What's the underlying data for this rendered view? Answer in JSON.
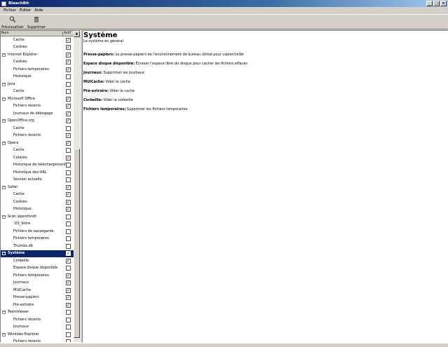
{
  "window": {
    "title": "BleachBit"
  },
  "menu": [
    "Fichier",
    "Éditer",
    "Aide"
  ],
  "toolbar": {
    "preview_label": "Prévisualiser",
    "delete_label": "Supprimer"
  },
  "tree": {
    "col_name": "Nom",
    "col_active": "Actif",
    "rows": [
      {
        "label": "Cache",
        "kind": "child",
        "checked": true
      },
      {
        "label": "Cookies",
        "kind": "child",
        "checked": true
      },
      {
        "label": "Internet Explorer",
        "kind": "group",
        "checked": true
      },
      {
        "label": "Cookies",
        "kind": "child",
        "checked": true
      },
      {
        "label": "Fichiers temporaires",
        "kind": "child",
        "checked": true
      },
      {
        "label": "Historique",
        "kind": "child",
        "checked": false
      },
      {
        "label": "Java",
        "kind": "group",
        "checked": false
      },
      {
        "label": "Cache",
        "kind": "child",
        "checked": false
      },
      {
        "label": "Microsoft Office",
        "kind": "group",
        "checked": true
      },
      {
        "label": "Fichiers récents",
        "kind": "child",
        "checked": true
      },
      {
        "label": "Journaux de débogage",
        "kind": "child",
        "checked": true
      },
      {
        "label": "OpenOffice.org",
        "kind": "group",
        "checked": true
      },
      {
        "label": "Cache",
        "kind": "child",
        "checked": false
      },
      {
        "label": "Fichiers récents",
        "kind": "child",
        "checked": true
      },
      {
        "label": "Opera",
        "kind": "group",
        "checked": true
      },
      {
        "label": "Cache",
        "kind": "child",
        "checked": false
      },
      {
        "label": "Cookies",
        "kind": "child",
        "checked": true
      },
      {
        "label": "Historique de téléchargement",
        "kind": "child",
        "checked": false
      },
      {
        "label": "Historique des URL",
        "kind": "child",
        "checked": false
      },
      {
        "label": "Session actuelle",
        "kind": "child",
        "checked": false
      },
      {
        "label": "Safari",
        "kind": "group",
        "checked": true
      },
      {
        "label": "Cache",
        "kind": "child",
        "checked": true
      },
      {
        "label": "Cookies",
        "kind": "child",
        "checked": true
      },
      {
        "label": "Historique",
        "kind": "child",
        "checked": true
      },
      {
        "label": "Scan approfondi",
        "kind": "group",
        "checked": false
      },
      {
        "label": ".DS_Store",
        "kind": "child",
        "checked": false
      },
      {
        "label": "Fichiers de sauvegarde",
        "kind": "child",
        "checked": false
      },
      {
        "label": "Fichiers temporaires",
        "kind": "child",
        "checked": false
      },
      {
        "label": "Thumbs.db",
        "kind": "child",
        "checked": false
      },
      {
        "label": "Système",
        "kind": "group",
        "checked": true,
        "selected": true
      },
      {
        "label": "Corbeille",
        "kind": "child",
        "checked": true
      },
      {
        "label": "Espace disque disponible",
        "kind": "child",
        "checked": false
      },
      {
        "label": "Fichiers temporaires",
        "kind": "child",
        "checked": true
      },
      {
        "label": "Journaux",
        "kind": "child",
        "checked": true
      },
      {
        "label": "MUICache",
        "kind": "child",
        "checked": true
      },
      {
        "label": "Presse-papiers",
        "kind": "child",
        "checked": true
      },
      {
        "label": "Pré-extraire",
        "kind": "child",
        "checked": true
      },
      {
        "label": "TeamViewer",
        "kind": "group",
        "checked": false
      },
      {
        "label": "Fichiers récents",
        "kind": "child",
        "checked": false
      },
      {
        "label": "Journaux",
        "kind": "child",
        "checked": false
      },
      {
        "label": "Windows Explorer",
        "kind": "group",
        "checked": false
      },
      {
        "label": "Fichiers récents",
        "kind": "child",
        "checked": false
      }
    ]
  },
  "content": {
    "title": "Système",
    "subtitle": "Le système en général",
    "descriptions": [
      {
        "term": "Presse-papiers:",
        "text": " Le presse-papiers de l'environnement de bureau utilisé pour copier/coller"
      },
      {
        "term": "Espace disque disponible:",
        "text": " Écraser l'espace libre du disque pour cacher les fichiers effacés"
      },
      {
        "term": "Journaux:",
        "text": " Supprimer les journaux"
      },
      {
        "term": "MUICache:",
        "text": " Vider le cache"
      },
      {
        "term": "Pré-extraire:",
        "text": " Vider le cache"
      },
      {
        "term": "Corbeille:",
        "text": " Vider la corbeille"
      },
      {
        "term": "Fichiers temporaires:",
        "text": " Supprimer les fichiers temporaires"
      }
    ]
  },
  "icons": {
    "expander": "minus-box-icon",
    "check": "✓"
  }
}
